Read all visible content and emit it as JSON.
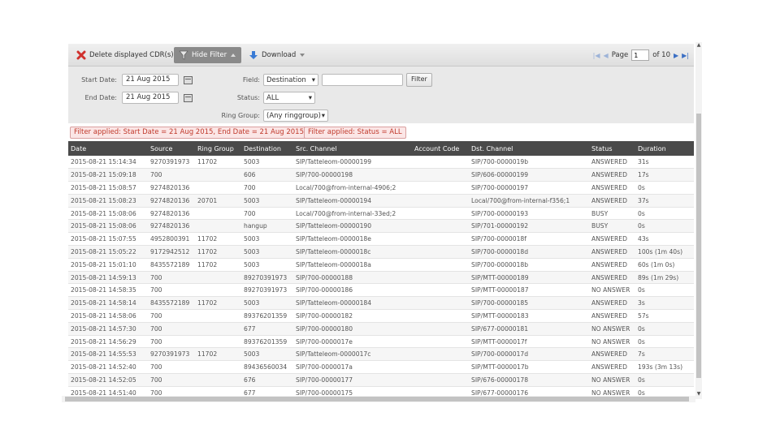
{
  "toolbar": {
    "delete_label": "Delete displayed CDR(s)",
    "hide_filter_label": "Hide Filter",
    "download_label": "Download"
  },
  "pager": {
    "page_label": "Page",
    "page_value": "1",
    "of_label": "of 10"
  },
  "filters": {
    "start_date_label": "Start Date:",
    "start_date_value": "21 Aug 2015",
    "end_date_label": "End Date:",
    "end_date_value": "21 Aug 2015",
    "field_label": "Field:",
    "field_value": "Destination",
    "field_text_value": "",
    "filter_button": "Filter",
    "status_label": "Status:",
    "status_value": "ALL",
    "ring_group_label": "Ring Group:",
    "ring_group_value": "(Any ringgroup)"
  },
  "applied": {
    "date_filter": "Filter applied: Start Date = 21 Aug 2015, End Date = 21 Aug 2015",
    "status_filter": "Filter applied: Status = ALL"
  },
  "table": {
    "columns": [
      "Date",
      "Source",
      "Ring Group",
      "Destination",
      "Src. Channel",
      "Account Code",
      "Dst. Channel",
      "Status",
      "Duration"
    ],
    "rows": [
      [
        "2015-08-21 15:14:34",
        "9270391973",
        "11702",
        "5003",
        "SIP/Tatteleom-00000199",
        "",
        "SIP/700-0000019b",
        "ANSWERED",
        "31s"
      ],
      [
        "2015-08-21 15:09:18",
        "700",
        "",
        "606",
        "SIP/700-00000198",
        "",
        "SIP/606-00000199",
        "ANSWERED",
        "17s"
      ],
      [
        "2015-08-21 15:08:57",
        "9274820136",
        "",
        "700",
        "Local/700@from-internal-4906;2",
        "",
        "SIP/700-00000197",
        "ANSWERED",
        "0s"
      ],
      [
        "2015-08-21 15:08:23",
        "9274820136",
        "20701",
        "5003",
        "SIP/Tatteleom-00000194",
        "",
        "Local/700@from-internal-f356;1",
        "ANSWERED",
        "37s"
      ],
      [
        "2015-08-21 15:08:06",
        "9274820136",
        "",
        "700",
        "Local/700@from-internal-33ed;2",
        "",
        "SIP/700-00000193",
        "BUSY",
        "0s"
      ],
      [
        "2015-08-21 15:08:06",
        "9274820136",
        "",
        "hangup",
        "SIP/Tatteleom-00000190",
        "",
        "SIP/701-00000192",
        "BUSY",
        "0s"
      ],
      [
        "2015-08-21 15:07:55",
        "4952800391",
        "11702",
        "5003",
        "SIP/Tatteleom-0000018e",
        "",
        "SIP/700-0000018f",
        "ANSWERED",
        "43s"
      ],
      [
        "2015-08-21 15:05:22",
        "9172942512",
        "11702",
        "5003",
        "SIP/Tatteleom-0000018c",
        "",
        "SIP/700-0000018d",
        "ANSWERED",
        "100s (1m 40s)"
      ],
      [
        "2015-08-21 15:01:10",
        "8435572189",
        "11702",
        "5003",
        "SIP/Tatteleom-0000018a",
        "",
        "SIP/700-0000018b",
        "ANSWERED",
        "60s (1m 0s)"
      ],
      [
        "2015-08-21 14:59:13",
        "700",
        "",
        "89270391973",
        "SIP/700-00000188",
        "",
        "SIP/MTT-00000189",
        "ANSWERED",
        "89s (1m 29s)"
      ],
      [
        "2015-08-21 14:58:35",
        "700",
        "",
        "89270391973",
        "SIP/700-00000186",
        "",
        "SIP/MTT-00000187",
        "NO ANSWER",
        "0s"
      ],
      [
        "2015-08-21 14:58:14",
        "8435572189",
        "11702",
        "5003",
        "SIP/Tatteleom-00000184",
        "",
        "SIP/700-00000185",
        "ANSWERED",
        "3s"
      ],
      [
        "2015-08-21 14:58:06",
        "700",
        "",
        "89376201359",
        "SIP/700-00000182",
        "",
        "SIP/MTT-00000183",
        "ANSWERED",
        "57s"
      ],
      [
        "2015-08-21 14:57:30",
        "700",
        "",
        "677",
        "SIP/700-00000180",
        "",
        "SIP/677-00000181",
        "NO ANSWER",
        "0s"
      ],
      [
        "2015-08-21 14:56:29",
        "700",
        "",
        "89376201359",
        "SIP/700-0000017e",
        "",
        "SIP/MTT-0000017f",
        "NO ANSWER",
        "0s"
      ],
      [
        "2015-08-21 14:55:53",
        "9270391973",
        "11702",
        "5003",
        "SIP/Tatteleom-0000017c",
        "",
        "SIP/700-0000017d",
        "ANSWERED",
        "7s"
      ],
      [
        "2015-08-21 14:52:40",
        "700",
        "",
        "89436560034",
        "SIP/700-0000017a",
        "",
        "SIP/MTT-0000017b",
        "ANSWERED",
        "193s (3m 13s)"
      ],
      [
        "2015-08-21 14:52:05",
        "700",
        "",
        "676",
        "SIP/700-00000177",
        "",
        "SIP/676-00000178",
        "NO ANSWER",
        "0s"
      ],
      [
        "2015-08-21 14:51:40",
        "700",
        "",
        "677",
        "SIP/700-00000175",
        "",
        "SIP/677-00000176",
        "NO ANSWER",
        "0s"
      ]
    ]
  },
  "colors": {
    "header_bg": "#4a4a4a",
    "filter_alert": "#c0392b",
    "delete_icon": "#d0312d",
    "download_icon": "#3a7bd5"
  }
}
